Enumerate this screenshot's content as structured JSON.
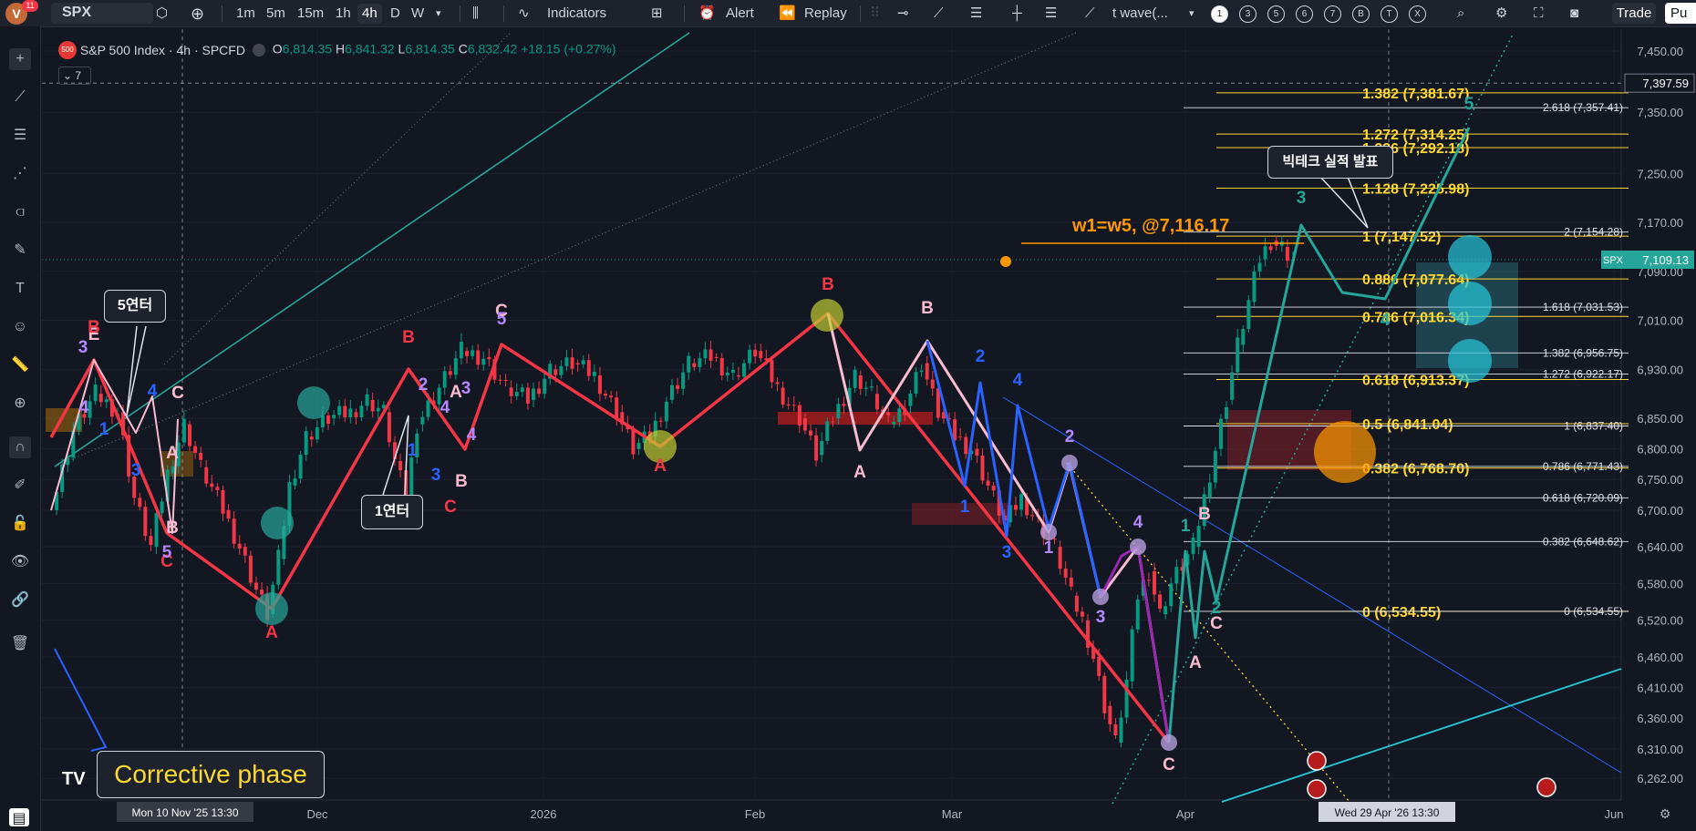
{
  "toolbar": {
    "avatar_letter": "V",
    "notif_count": "11",
    "symbol": "SPX",
    "intervals": [
      "1m",
      "5m",
      "15m",
      "1h",
      "4h",
      "D",
      "W"
    ],
    "indicators_label": "Indicators",
    "alert_label": "Alert",
    "replay_label": "Replay",
    "drawing_name": "t wave(...",
    "circles": [
      "1",
      "3",
      "5",
      "6",
      "7",
      "B",
      "T",
      "X"
    ],
    "trade_label": "Trade",
    "publish_label": "Pu"
  },
  "legend": {
    "badge": "500",
    "title": "S&P 500 Index · 4h · SPCFD",
    "o_label": "O",
    "o": "6,814.35",
    "h_label": "H",
    "h": "6,841.32",
    "l_label": "L",
    "l": "6,814.35",
    "c_label": "C",
    "c": "6,832.42",
    "change": "+18.15 (+0.27%)",
    "collapse": "7"
  },
  "colors": {
    "up": "#089981",
    "down": "#f23645",
    "wave_red": "#f23645",
    "wave_teal": "#26a69a",
    "wave_blue": "#2962ff",
    "wave_pink": "#f8bbd0",
    "fib": "#fdd835"
  },
  "chart_data": {
    "type": "candlestick",
    "symbol": "SPX",
    "timeframe": "4h",
    "x_ticks": [
      "Dec",
      "2026",
      "Feb",
      "Mar",
      "Apr",
      "Jun"
    ],
    "y_ticks": [
      "7,450.00",
      "7,350.00",
      "7,250.00",
      "7,170.00",
      "7,090.00",
      "7,010.00",
      "6,930.00",
      "6,850.00",
      "6,800.00",
      "6,750.00",
      "6,700.00",
      "6,640.00",
      "6,580.00",
      "6,520.00",
      "6,460.00",
      "6,410.00",
      "6,360.00",
      "6,310.00",
      "6,262.00"
    ],
    "ylim": [
      6230,
      7490
    ],
    "last_price": {
      "symbol": "SPX",
      "value": "7,109.13",
      "y": 7109.13
    },
    "crosshair": {
      "price_label": "7,397.59",
      "price": 7397.59,
      "time_label": "Mon 10 Nov '25   13:30",
      "time_label2": "Wed 29 Apr '26   13:30"
    },
    "price_path": [
      [
        0,
        6700
      ],
      [
        4,
        6830
      ],
      [
        8,
        6890
      ],
      [
        12,
        6860
      ],
      [
        15,
        6720
      ],
      [
        18,
        6640
      ],
      [
        21,
        6760
      ],
      [
        24,
        6840
      ],
      [
        27,
        6770
      ],
      [
        31,
        6700
      ],
      [
        34,
        6640
      ],
      [
        37,
        6570
      ],
      [
        39,
        6530
      ],
      [
        41,
        6620
      ],
      [
        43,
        6740
      ],
      [
        46,
        6820
      ],
      [
        50,
        6850
      ],
      [
        54,
        6860
      ],
      [
        57,
        6880
      ],
      [
        60,
        6860
      ],
      [
        62,
        6780
      ],
      [
        64,
        6720
      ],
      [
        66,
        6840
      ],
      [
        70,
        6900
      ],
      [
        74,
        6960
      ],
      [
        78,
        6950
      ],
      [
        82,
        6900
      ],
      [
        86,
        6880
      ],
      [
        90,
        6930
      ],
      [
        94,
        6940
      ],
      [
        98,
        6920
      ],
      [
        102,
        6860
      ],
      [
        105,
        6800
      ],
      [
        108,
        6820
      ],
      [
        111,
        6880
      ],
      [
        115,
        6940
      ],
      [
        119,
        6950
      ],
      [
        123,
        6920
      ],
      [
        127,
        6960
      ],
      [
        131,
        6900
      ],
      [
        135,
        6850
      ],
      [
        138,
        6790
      ],
      [
        141,
        6850
      ],
      [
        145,
        6920
      ],
      [
        148,
        6890
      ],
      [
        151,
        6840
      ],
      [
        154,
        6870
      ],
      [
        157,
        6940
      ],
      [
        160,
        6860
      ],
      [
        163,
        6820
      ],
      [
        166,
        6800
      ],
      [
        169,
        6740
      ],
      [
        172,
        6680
      ],
      [
        175,
        6720
      ],
      [
        178,
        6680
      ],
      [
        181,
        6640
      ],
      [
        184,
        6560
      ],
      [
        186,
        6520
      ],
      [
        188,
        6460
      ],
      [
        190,
        6380
      ],
      [
        192,
        6320
      ],
      [
        194,
        6420
      ],
      [
        196,
        6560
      ],
      [
        198,
        6600
      ],
      [
        200,
        6530
      ],
      [
        202,
        6580
      ],
      [
        204,
        6610
      ],
      [
        206,
        6640
      ],
      [
        208,
        6720
      ],
      [
        210,
        6800
      ],
      [
        212,
        6880
      ],
      [
        214,
        6970
      ],
      [
        216,
        7040
      ],
      [
        218,
        7110
      ],
      [
        220,
        7140
      ],
      [
        222,
        7130
      ],
      [
        224,
        7109
      ]
    ],
    "fib_left": [
      {
        "label": "1.382 (7,381.67)",
        "y": 7381.67
      },
      {
        "label": "1.272 (7,314.25)",
        "y": 7314.25
      },
      {
        "label": "1.236 (7,292.18)",
        "y": 7292.18
      },
      {
        "label": "1.128 (7,225.98)",
        "y": 7225.98
      },
      {
        "label": "1 (7,147.52)",
        "y": 7147.52
      },
      {
        "label": "0.886 (7,077.64)",
        "y": 7077.64
      },
      {
        "label": "0.786 (7,016.34)",
        "y": 7016.34
      },
      {
        "label": "0.618 (6,913.37)",
        "y": 6913.37
      },
      {
        "label": "0.5 (6,841.04)",
        "y": 6841.04
      },
      {
        "label": "0.382 (6,768.70)",
        "y": 6768.7
      },
      {
        "label": "0 (6,534.55)",
        "y": 6534.55
      }
    ],
    "fib_right": [
      {
        "label": "2.618 (7,357.41)",
        "y": 7357.41
      },
      {
        "label": "2 (7,154.28)",
        "y": 7154.28
      },
      {
        "label": "1.618 (7,031.53)",
        "y": 7031.53
      },
      {
        "label": "1.382 (6,956.75)",
        "y": 6956.75
      },
      {
        "label": "1.272 (6,922.17)",
        "y": 6922.17
      },
      {
        "label": "1 (6,837.40)",
        "y": 6837.4
      },
      {
        "label": "0.786 (6,771.43)",
        "y": 6771.43
      },
      {
        "label": "0.618 (6,720.09)",
        "y": 6720.09
      },
      {
        "label": "0.382 (6,648.62)",
        "y": 6648.62
      },
      {
        "label": "0 (6,534.55)",
        "y": 6534.55
      }
    ],
    "target_label": "w1=w5, @7,116.17",
    "annotations": {
      "bubble_5": "5연터",
      "bubble_1": "1연터",
      "bubble_bigtech": "빅테크 실적 발표",
      "corrective": "Corrective phase"
    },
    "wave_labels": [
      {
        "t": "E",
        "color": "#f8bbd0",
        "x": 103,
        "y": 373
      },
      {
        "t": "B",
        "color": "#f23645",
        "x": 103,
        "y": 365
      },
      {
        "t": "3",
        "color": "#b388ff",
        "x": 91,
        "y": 387
      },
      {
        "t": "4",
        "color": "#b388ff",
        "x": 92,
        "y": 453
      },
      {
        "t": "1",
        "color": "#2962ff",
        "x": 114,
        "y": 477
      },
      {
        "t": "3",
        "color": "#2962ff",
        "x": 149,
        "y": 522
      },
      {
        "t": "4",
        "color": "#2962ff",
        "x": 167,
        "y": 435
      },
      {
        "t": "C",
        "color": "#f8bbd0",
        "x": 195,
        "y": 437
      },
      {
        "t": "A",
        "color": "#f8bbd0",
        "x": 189,
        "y": 503
      },
      {
        "t": "B",
        "color": "#f8bbd0",
        "x": 189,
        "y": 585
      },
      {
        "t": "C",
        "color": "#f23645",
        "x": 183,
        "y": 622
      },
      {
        "t": "5",
        "color": "#b388ff",
        "x": 183,
        "y": 612
      },
      {
        "t": "A",
        "color": "#f23645",
        "x": 298,
        "y": 700
      },
      {
        "t": "B",
        "color": "#f23645",
        "x": 448,
        "y": 376
      },
      {
        "t": "2",
        "color": "#b388ff",
        "x": 464,
        "y": 428
      },
      {
        "t": "4",
        "color": "#b388ff",
        "x": 488,
        "y": 453
      },
      {
        "t": "1",
        "color": "#2962ff",
        "x": 452,
        "y": 500
      },
      {
        "t": "3",
        "color": "#2962ff",
        "x": 478,
        "y": 527
      },
      {
        "t": "A",
        "color": "#f8bbd0",
        "x": 500,
        "y": 436
      },
      {
        "t": "3",
        "color": "#b388ff",
        "x": 511,
        "y": 432
      },
      {
        "t": "C",
        "color": "#f23645",
        "x": 494,
        "y": 562
      },
      {
        "t": "B",
        "color": "#f8bbd0",
        "x": 506,
        "y": 534
      },
      {
        "t": "4",
        "color": "#b388ff",
        "x": 517,
        "y": 483
      },
      {
        "t": "C",
        "color": "#f8bbd0",
        "x": 550,
        "y": 347
      },
      {
        "t": "5",
        "color": "#b388ff",
        "x": 550,
        "y": 356
      },
      {
        "t": "A",
        "color": "#f23645",
        "x": 724,
        "y": 517
      },
      {
        "t": "B",
        "color": "#f23645",
        "x": 908,
        "y": 318
      },
      {
        "t": "B",
        "color": "#f8bbd0",
        "x": 1017,
        "y": 344
      },
      {
        "t": "A",
        "color": "#f8bbd0",
        "x": 943,
        "y": 524
      },
      {
        "t": "2",
        "color": "#2962ff",
        "x": 1075,
        "y": 397
      },
      {
        "t": "4",
        "color": "#2962ff",
        "x": 1116,
        "y": 423
      },
      {
        "t": "1",
        "color": "#2962ff",
        "x": 1058,
        "y": 562
      },
      {
        "t": "3",
        "color": "#2962ff",
        "x": 1104,
        "y": 612
      },
      {
        "t": "2",
        "color": "#b388ff",
        "x": 1173,
        "y": 485
      },
      {
        "t": "1",
        "color": "#b388ff",
        "x": 1150,
        "y": 607
      },
      {
        "t": "3",
        "color": "#b388ff",
        "x": 1207,
        "y": 683
      },
      {
        "t": "4",
        "color": "#b388ff",
        "x": 1248,
        "y": 579
      },
      {
        "t": "C",
        "color": "#f8bbd0",
        "x": 1282,
        "y": 845
      },
      {
        "t": "A",
        "color": "#f8bbd0",
        "x": 1311,
        "y": 733
      },
      {
        "t": "1",
        "color": "#26a69a",
        "x": 1300,
        "y": 583
      },
      {
        "t": "B",
        "color": "#f8bbd0",
        "x": 1321,
        "y": 570
      },
      {
        "t": "C",
        "color": "#f8bbd0",
        "x": 1334,
        "y": 690
      },
      {
        "t": "2",
        "color": "#26a69a",
        "x": 1334,
        "y": 673
      },
      {
        "t": "3",
        "color": "#26a69a",
        "x": 1427,
        "y": 223
      },
      {
        "t": "4",
        "color": "#26a69a",
        "x": 1519,
        "y": 357
      },
      {
        "t": "5",
        "color": "#26a69a",
        "x": 1611,
        "y": 120
      }
    ]
  }
}
